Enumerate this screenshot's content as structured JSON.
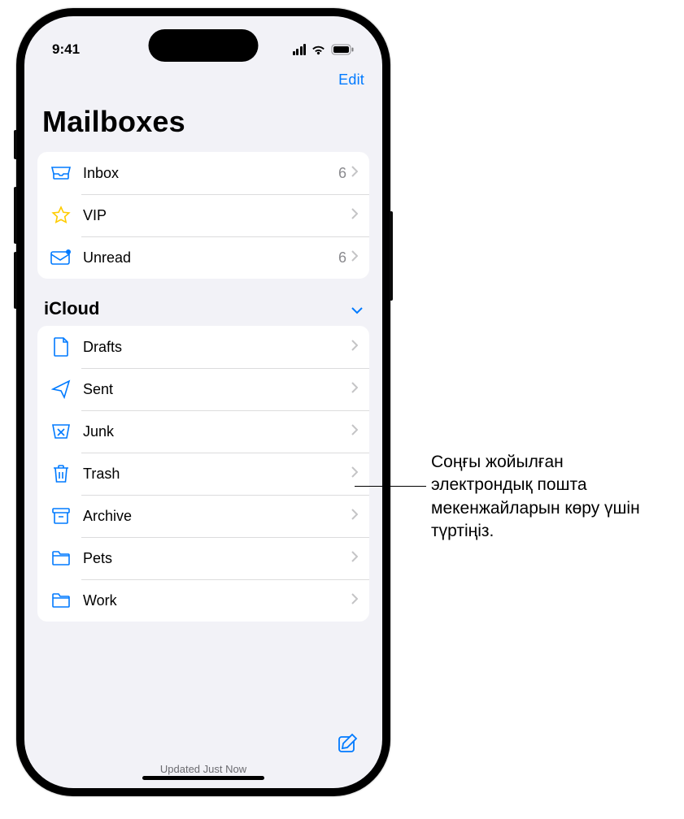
{
  "status": {
    "time": "9:41"
  },
  "nav": {
    "edit_label": "Edit"
  },
  "page_title": "Mailboxes",
  "top_mailboxes": [
    {
      "icon": "inbox",
      "label": "Inbox",
      "count": "6"
    },
    {
      "icon": "star",
      "label": "VIP",
      "count": ""
    },
    {
      "icon": "unread",
      "label": "Unread",
      "count": "6"
    }
  ],
  "account": {
    "name": "iCloud"
  },
  "folders": [
    {
      "icon": "drafts",
      "label": "Drafts"
    },
    {
      "icon": "sent",
      "label": "Sent"
    },
    {
      "icon": "junk",
      "label": "Junk"
    },
    {
      "icon": "trash",
      "label": "Trash"
    },
    {
      "icon": "archive",
      "label": "Archive"
    },
    {
      "icon": "folder",
      "label": "Pets"
    },
    {
      "icon": "folder",
      "label": "Work"
    }
  ],
  "toolbar": {
    "status": "Updated Just Now"
  },
  "callout": {
    "text": "Соңғы жойылған электрондық пошта мекенжайларын көру үшін түртіңіз."
  },
  "colors": {
    "accent": "#007aff",
    "star": "#ffcc00"
  }
}
